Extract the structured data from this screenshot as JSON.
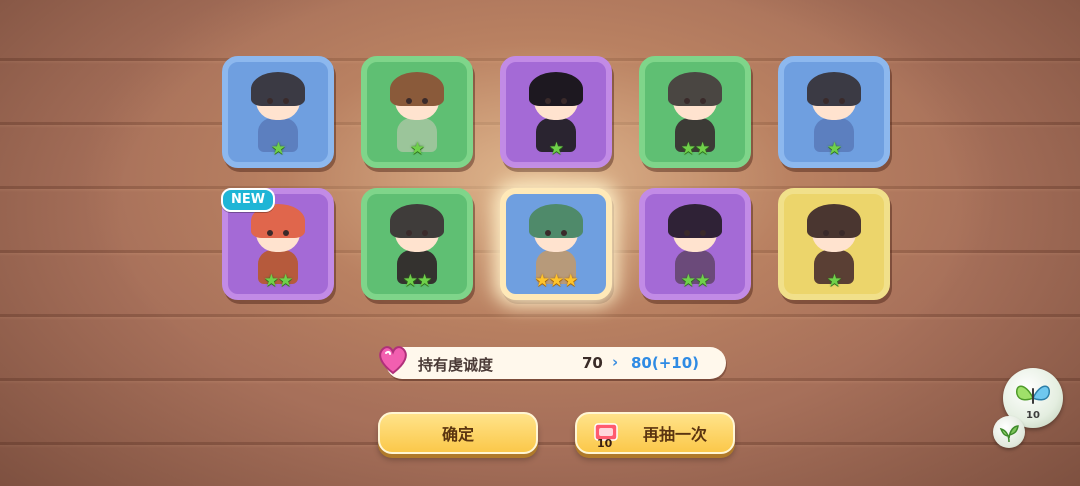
{
  "gacha_results": [
    {
      "name_slot": 1,
      "frame_color": "blue",
      "stars": 1,
      "star_type": "green",
      "hair": "#3b3a44",
      "outfit": "#5c7fbf"
    },
    {
      "name_slot": 2,
      "frame_color": "green",
      "stars": 1,
      "star_type": "green",
      "hair": "#8a5a3a",
      "outfit": "#9bc59a"
    },
    {
      "name_slot": 3,
      "frame_color": "purple",
      "stars": 1,
      "star_type": "green",
      "hair": "#1d1820",
      "outfit": "#2a2430"
    },
    {
      "name_slot": 4,
      "frame_color": "green",
      "stars": 2,
      "star_type": "green",
      "hair": "#4a4642",
      "outfit": "#3c3a36"
    },
    {
      "name_slot": 5,
      "frame_color": "blue",
      "stars": 1,
      "star_type": "green",
      "hair": "#3b3a44",
      "outfit": "#5c7fbf"
    },
    {
      "name_slot": 6,
      "frame_color": "purple",
      "stars": 2,
      "star_type": "green",
      "hair": "#e0664c",
      "outfit": "#b65a3c",
      "is_new": true
    },
    {
      "name_slot": 7,
      "frame_color": "green",
      "stars": 2,
      "star_type": "green",
      "hair": "#3f3c3a",
      "outfit": "#34322f"
    },
    {
      "name_slot": 8,
      "frame_color": "blue",
      "stars": 3,
      "star_type": "gold",
      "hair": "#4f8a6a",
      "outfit": "#b79a7a",
      "highlighted": true
    },
    {
      "name_slot": 9,
      "frame_color": "purple",
      "stars": 2,
      "star_type": "green",
      "hair": "#2f2236",
      "outfit": "#6b4a7a"
    },
    {
      "name_slot": 10,
      "frame_color": "yellow",
      "stars": 1,
      "star_type": "green",
      "hair": "#4a3630",
      "outfit": "#5a3f34"
    }
  ],
  "new_badge": "NEW",
  "devotion": {
    "label": "持有虔诚度",
    "old_value": "70",
    "arrow": "›",
    "new_value": "80(+10)",
    "icon": "heart-gem-icon"
  },
  "buttons": {
    "confirm_label": "确定",
    "redraw_label": "再抽一次",
    "ticket_count": "10",
    "ticket_icon": "ticket-icon"
  },
  "side_currency": {
    "count": "10",
    "icon": "butterfly-icon",
    "badge_icon": "sprout-icon"
  },
  "colors": {
    "green_star": "#6fd14a",
    "gold_star": "#ffc42a",
    "button_yellow": "#fbc84a",
    "new_badge": "#1fb5d6"
  }
}
